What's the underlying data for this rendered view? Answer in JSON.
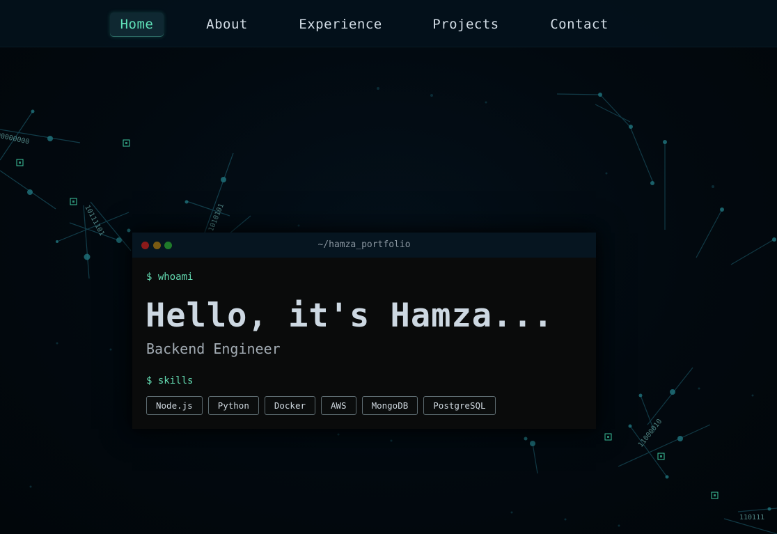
{
  "nav": {
    "items": [
      {
        "label": "Home",
        "active": true
      },
      {
        "label": "About",
        "active": false
      },
      {
        "label": "Experience",
        "active": false
      },
      {
        "label": "Projects",
        "active": false
      },
      {
        "label": "Contact",
        "active": false
      }
    ]
  },
  "terminal": {
    "title": "~/hamza_portfolio",
    "window_buttons": [
      "close",
      "minimize",
      "maximize"
    ],
    "command_1": "$ whoami",
    "greeting": "Hello, it's Hamza...",
    "role": "Backend Engineer",
    "command_2": "$ skills",
    "skills": [
      "Node.js",
      "Python",
      "Docker",
      "AWS",
      "MongoDB",
      "PostgreSQL"
    ]
  },
  "background": {
    "binary_fragments": [
      "00000000",
      "10111101",
      "1010101",
      "11000010",
      "110111"
    ]
  },
  "colors": {
    "accent": "#5fe0b8",
    "background": "#02080d",
    "terminal_bg": "#0a0b0b",
    "terminal_bar": "#061520",
    "dot_close": "#8c1a1a",
    "dot_minimize": "#7a5a12",
    "dot_maximize": "#1f7a2a"
  }
}
